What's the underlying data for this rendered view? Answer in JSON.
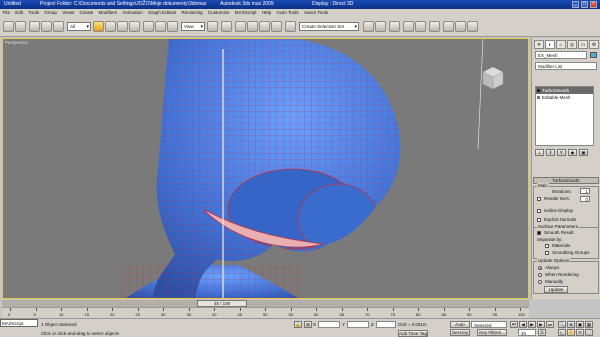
{
  "titlebar": {
    "app_title": "Untitled",
    "project_folder": "Project Folder: C:\\Documents and Settings\\JOŽO\\Moje dokumenty\\3dsmax",
    "app_name": "Autodesk 3ds max 2009",
    "display": "Display : Direct 3D"
  },
  "menu": [
    "File",
    "Edit",
    "Tools",
    "Group",
    "Views",
    "Create",
    "Modifiers",
    "Animation",
    "Graph Editors",
    "Rendering",
    "Customize",
    "MAXScript",
    "Help",
    "Axon Tools",
    "Aaron Tools"
  ],
  "toolbar": {
    "selection_filter": "All",
    "reference_coord": "View",
    "named_selection": "Create Selection Set"
  },
  "viewport": {
    "label": "Perspective"
  },
  "command_panel": {
    "object_name": "EX_Mesh",
    "modifier_list": "Modifier List",
    "stack": [
      {
        "label": "TurboSmooth",
        "selected": true
      },
      {
        "label": "Editable Mesh",
        "selected": false
      }
    ],
    "turbosmooth": {
      "title": "TurboSmooth",
      "main_label": "Main",
      "iterations_label": "Iterations:",
      "iterations_value": "1",
      "render_iters_label": "Render Iters:",
      "render_iters_value": "0",
      "isoline_display": "Isoline Display",
      "explicit_normals": "Explicit Normals",
      "surface_params_label": "Surface Parameters",
      "smooth_result": "Smooth Result",
      "separate_by": "Separate by:",
      "materials": "Materials",
      "smoothing_groups": "Smoothing Groups",
      "update_options_label": "Update Options",
      "always": "Always",
      "when_rendering": "When Rendering",
      "manually": "Manually",
      "update_button": "Update"
    }
  },
  "timeline": {
    "slider_label": "45 / 100",
    "ticks": [
      "0",
      "5",
      "10",
      "15",
      "20",
      "25",
      "30",
      "35",
      "40",
      "45",
      "50",
      "55",
      "60",
      "65",
      "70",
      "75",
      "80",
      "85",
      "90",
      "95",
      "100"
    ]
  },
  "status": {
    "maxscript": "MAXScript.",
    "selection": "1 Object Selected",
    "prompt": "Click or click-and-drag to select objects",
    "x_label": "X",
    "y_label": "Y",
    "z_label": "Z",
    "grid": "Grid = 0.001m",
    "add_time_tag": "Add Time Tag",
    "auto_key": "Auto Key",
    "set_key": "Set Key",
    "selected": "Selected",
    "key_filters": "Key Filters...",
    "frame": "45"
  }
}
